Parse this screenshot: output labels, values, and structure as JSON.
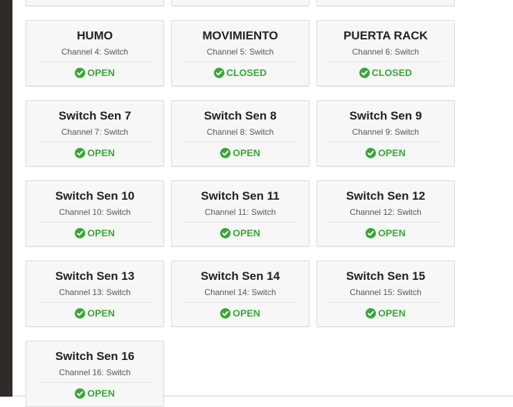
{
  "colors": {
    "status_ok": "#3aa63a",
    "card_bg": "#f7f7f7",
    "rail": "#2f2b29"
  },
  "cards": [
    {
      "title": "",
      "subtitle": "",
      "status": "",
      "icon": "",
      "partial": true
    },
    {
      "title": "",
      "subtitle": "",
      "status": "",
      "icon": "",
      "partial": true
    },
    {
      "title": "",
      "subtitle": "",
      "status": "",
      "icon": "",
      "partial": true
    },
    {
      "title": "HUMO",
      "subtitle": "Channel 4: Switch",
      "status": "OPEN",
      "icon": "check-circle-icon"
    },
    {
      "title": "MOVIMIENTO",
      "subtitle": "Channel 5: Switch",
      "status": "CLOSED",
      "icon": "check-circle-icon"
    },
    {
      "title": "PUERTA RACK",
      "subtitle": "Channel 6: Switch",
      "status": "CLOSED",
      "icon": "check-circle-icon"
    },
    {
      "title": "Switch Sen 7",
      "subtitle": "Channel 7: Switch",
      "status": "OPEN",
      "icon": "check-circle-icon"
    },
    {
      "title": "Switch Sen 8",
      "subtitle": "Channel 8: Switch",
      "status": "OPEN",
      "icon": "check-circle-icon"
    },
    {
      "title": "Switch Sen 9",
      "subtitle": "Channel 9: Switch",
      "status": "OPEN",
      "icon": "check-circle-icon"
    },
    {
      "title": "Switch Sen 10",
      "subtitle": "Channel 10: Switch",
      "status": "OPEN",
      "icon": "check-circle-icon"
    },
    {
      "title": "Switch Sen 11",
      "subtitle": "Channel 11: Switch",
      "status": "OPEN",
      "icon": "check-circle-icon"
    },
    {
      "title": "Switch Sen 12",
      "subtitle": "Channel 12: Switch",
      "status": "OPEN",
      "icon": "check-circle-icon"
    },
    {
      "title": "Switch Sen 13",
      "subtitle": "Channel 13: Switch",
      "status": "OPEN",
      "icon": "check-circle-icon"
    },
    {
      "title": "Switch Sen 14",
      "subtitle": "Channel 14: Switch",
      "status": "OPEN",
      "icon": "check-circle-icon"
    },
    {
      "title": "Switch Sen 15",
      "subtitle": "Channel 15: Switch",
      "status": "OPEN",
      "icon": "check-circle-icon"
    },
    {
      "title": "Switch Sen 16",
      "subtitle": "Channel 16: Switch",
      "status": "OPEN",
      "icon": "check-circle-icon"
    }
  ]
}
